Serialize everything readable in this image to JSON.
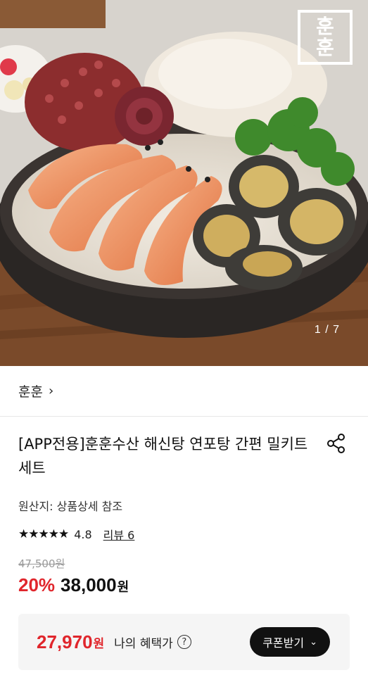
{
  "hero": {
    "brand_logo_top": "훈",
    "brand_logo_bottom": "훈",
    "image_counter": "1 / 7"
  },
  "store": {
    "name": "훈훈",
    "chevron": "›"
  },
  "product": {
    "title": "[APP전용]훈훈수산 해신탕 연포탕 간편 밀키트 세트",
    "origin": "원산지: 상품상세 참조",
    "stars": "★★★★★",
    "rating": "4.8",
    "review_label": "리뷰 6",
    "original_price": "47,500원",
    "discount": "20%",
    "price": "38,000",
    "price_unit": "원"
  },
  "benefit": {
    "price": "27,970",
    "unit": "원",
    "label": "나의 혜택가",
    "help": "?",
    "coupon_button": "쿠폰받기",
    "coupon_chevron": "⌄"
  },
  "colors": {
    "accent_red": "#e0262c",
    "button_dark": "#111111",
    "benefit_bg": "#f5f5f5"
  },
  "icons": [
    "share-icon",
    "help-icon",
    "chevron-right-icon",
    "chevron-down-icon",
    "star-icon"
  ]
}
